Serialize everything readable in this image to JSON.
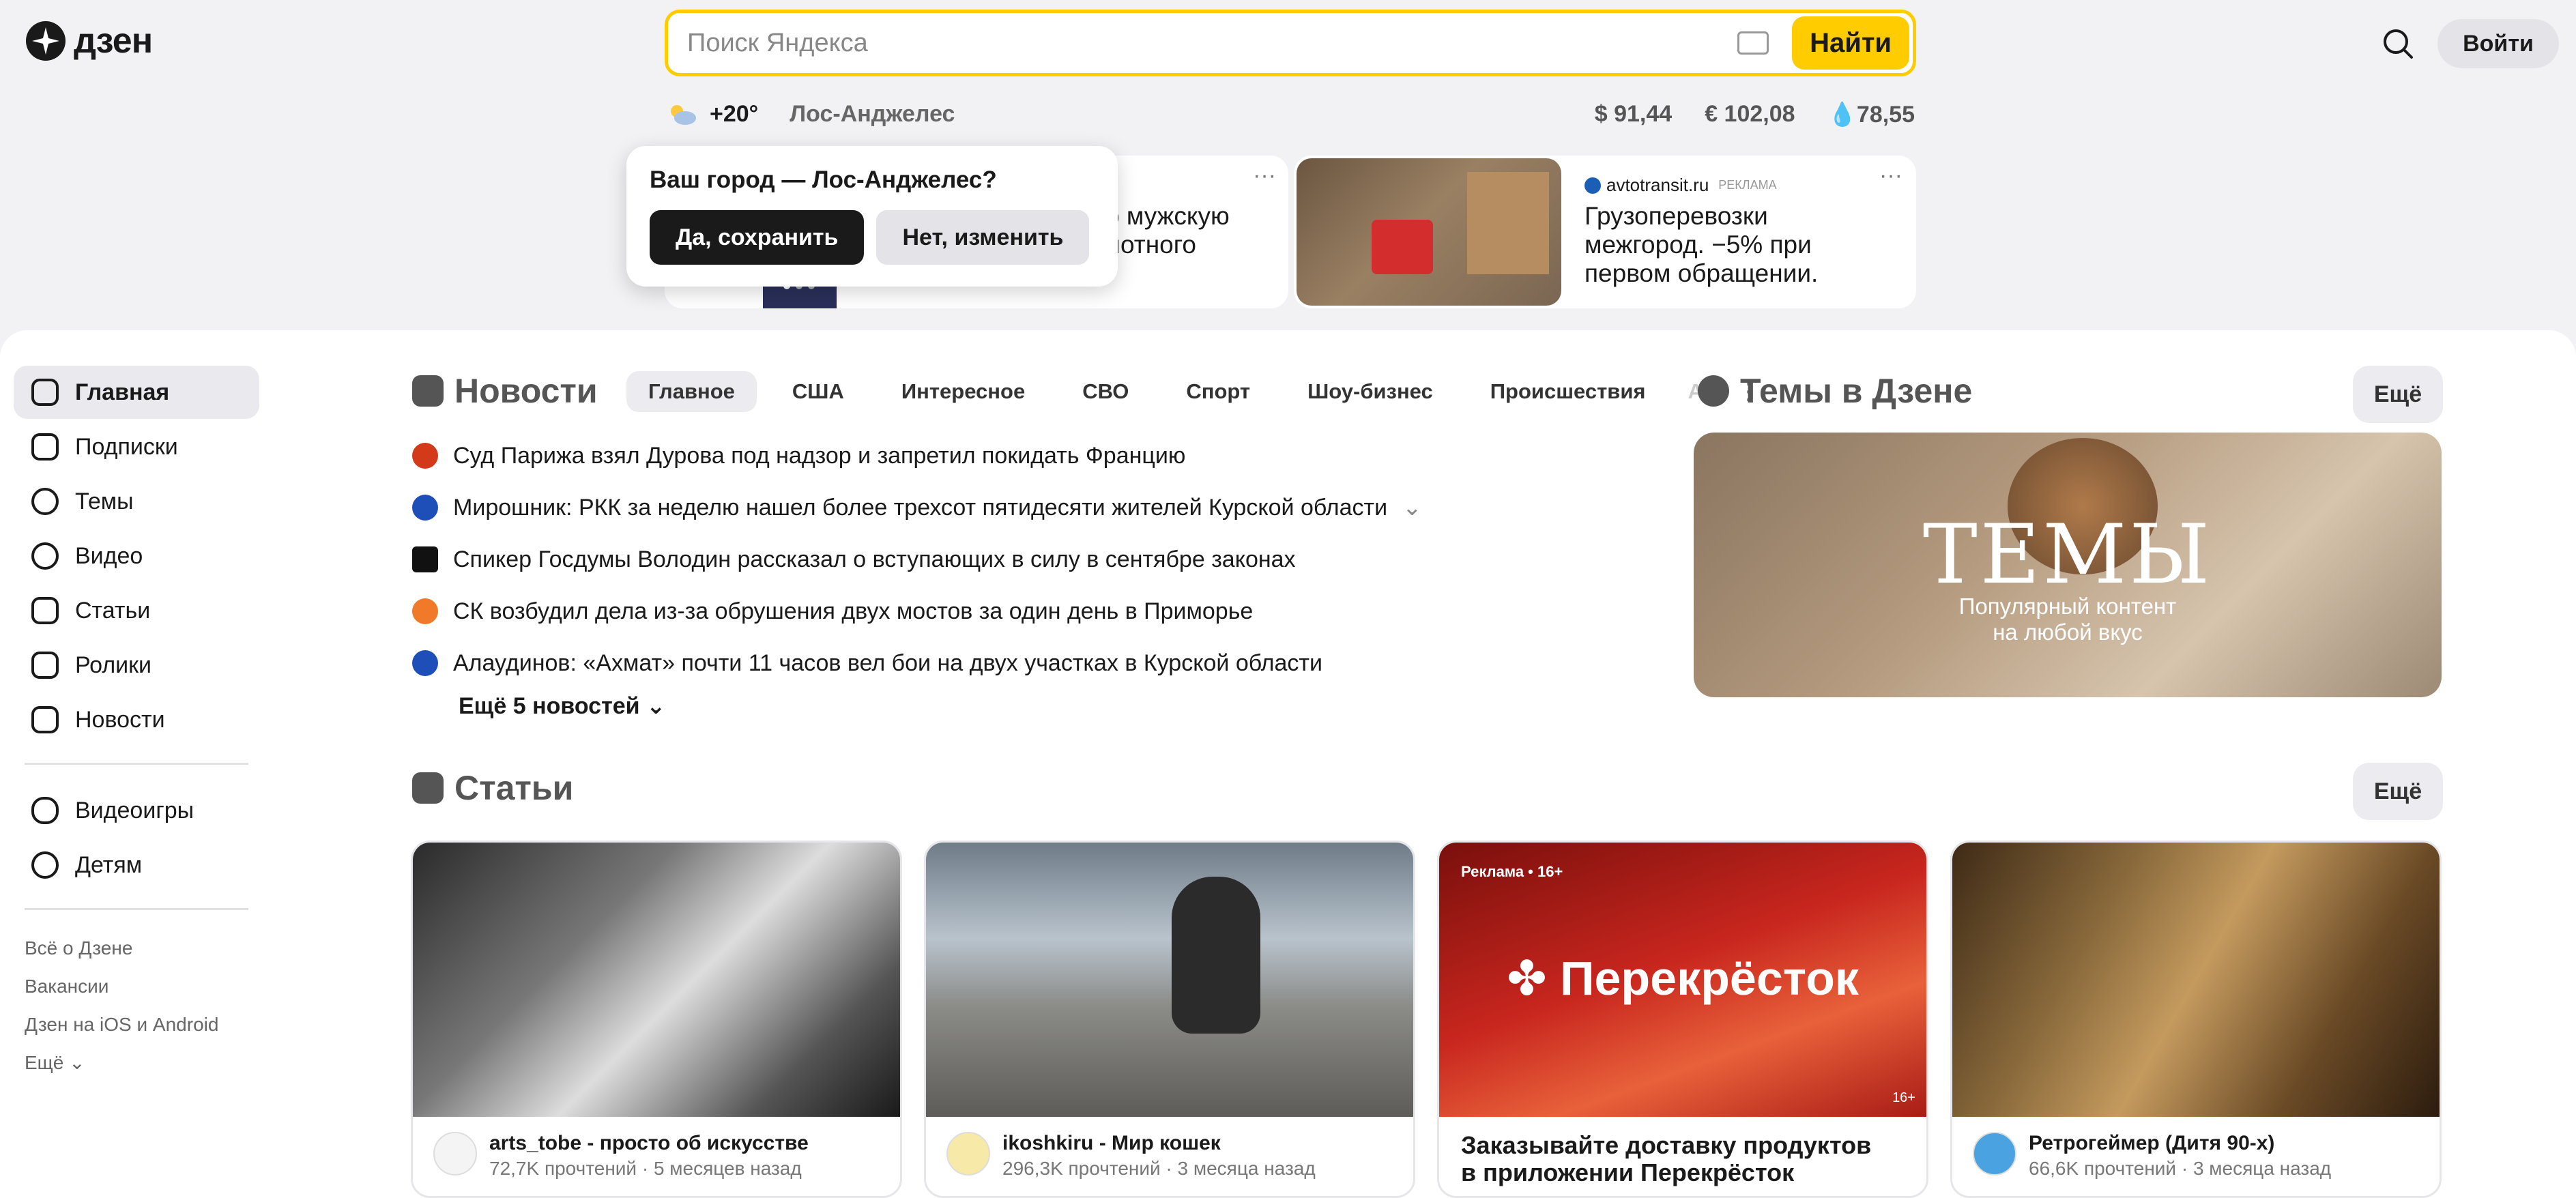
{
  "header": {
    "logo_text": "дзен",
    "search_placeholder": "Поиск Яндекса",
    "search_button": "Найти",
    "login_button": "Войти"
  },
  "weather": {
    "temp": "+20°",
    "city": "Лос-Анджелес"
  },
  "rates": {
    "usd": "$ 91,44",
    "eur": "€ 102,08",
    "oil": "78,55"
  },
  "ads": [
    {
      "text_line1": "о мужскую",
      "text_line2": "лотного"
    },
    {
      "source": "avtotransit.ru",
      "badge": "РЕКЛАМА",
      "text": "Грузоперевозки межгород. −5% при первом обращении."
    }
  ],
  "city_popup": {
    "question": "Ваш город — Лос-Анджелес?",
    "confirm": "Да, сохранить",
    "change": "Нет, изменить"
  },
  "sidebar": {
    "items": [
      {
        "label": "Главная"
      },
      {
        "label": "Подписки"
      },
      {
        "label": "Темы"
      },
      {
        "label": "Видео"
      },
      {
        "label": "Статьи"
      },
      {
        "label": "Ролики"
      },
      {
        "label": "Новости"
      },
      {
        "label": "Видеоигры"
      },
      {
        "label": "Детям"
      }
    ],
    "footer": [
      "Всё о Дзене",
      "Вакансии",
      "Дзен на iOS и Android",
      "Ещё"
    ]
  },
  "news": {
    "title": "Новости",
    "tabs": [
      "Главное",
      "США",
      "Интересное",
      "СВО",
      "Спорт",
      "Шоу-бизнес",
      "Происшествия",
      "Ав"
    ],
    "items": [
      {
        "text": "Суд Парижа взял Дурова под надзор и запретил покидать Францию",
        "color": "#d23a1a"
      },
      {
        "text": "Мирошник: РКК за неделю нашел более трехсот пятидесяти жителей Курской области",
        "color": "#1e4fb8"
      },
      {
        "text": "Спикер Госдумы Володин рассказал о вступающих в силу в сентябре законах",
        "color": "#111111"
      },
      {
        "text": "СК возбудил дела из-за обрушения двух мостов за один день в Приморье",
        "color": "#f07a2a"
      },
      {
        "text": "Алаудинов: «Ахмат» почти 11 часов вел бои на двух участках в Курской области",
        "color": "#1e4fb8"
      }
    ],
    "more": "Ещё 5 новостей"
  },
  "themes": {
    "title": "Темы в Дзене",
    "more": "Ещё",
    "banner_title": "ТЕМЫ",
    "banner_sub1": "Популярный контент",
    "banner_sub2": "на любой вкус"
  },
  "articles": {
    "title": "Статьи",
    "more": "Ещё",
    "cards": [
      {
        "channel": "arts_tobe - просто об искусстве",
        "stats": "72,7K прочтений · 5 месяцев назад"
      },
      {
        "channel": "ikoshkiru - Мир кошек",
        "stats": "296,3K прочтений · 3 месяца назад"
      },
      {
        "ad_label": "Реклама • 16+",
        "brand": "Перекрёсток",
        "age": "16+",
        "title1": "Заказывайте доставку продуктов",
        "title2": "в приложении Перекрёсток"
      },
      {
        "channel": "Ретрогеймер (Дитя 90-х)",
        "stats": "66,6K прочтений · 3 месяца назад"
      }
    ]
  },
  "colors": {
    "accent": "#ffcc00",
    "bg": "#f2f2f4",
    "promo_red": "#c8261e"
  }
}
